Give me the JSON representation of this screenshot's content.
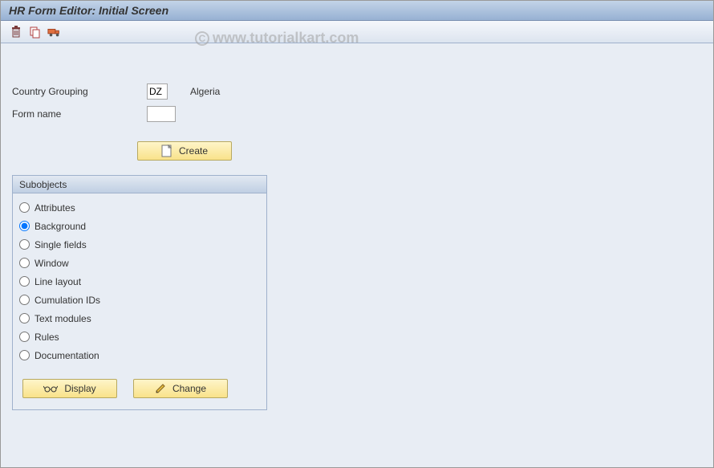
{
  "title": "HR Form Editor: Initial Screen",
  "watermark": "www.tutorialkart.com",
  "fields": {
    "country_grouping_label": "Country Grouping",
    "country_grouping_value": "DZ",
    "country_grouping_text": "Algeria",
    "form_name_label": "Form name",
    "form_name_value": ""
  },
  "buttons": {
    "create": "Create",
    "display": "Display",
    "change": "Change"
  },
  "subobjects": {
    "title": "Subobjects",
    "selected": "Background",
    "items": [
      "Attributes",
      "Background",
      "Single fields",
      "Window",
      "Line layout",
      "Cumulation IDs",
      "Text modules",
      "Rules",
      "Documentation"
    ]
  }
}
